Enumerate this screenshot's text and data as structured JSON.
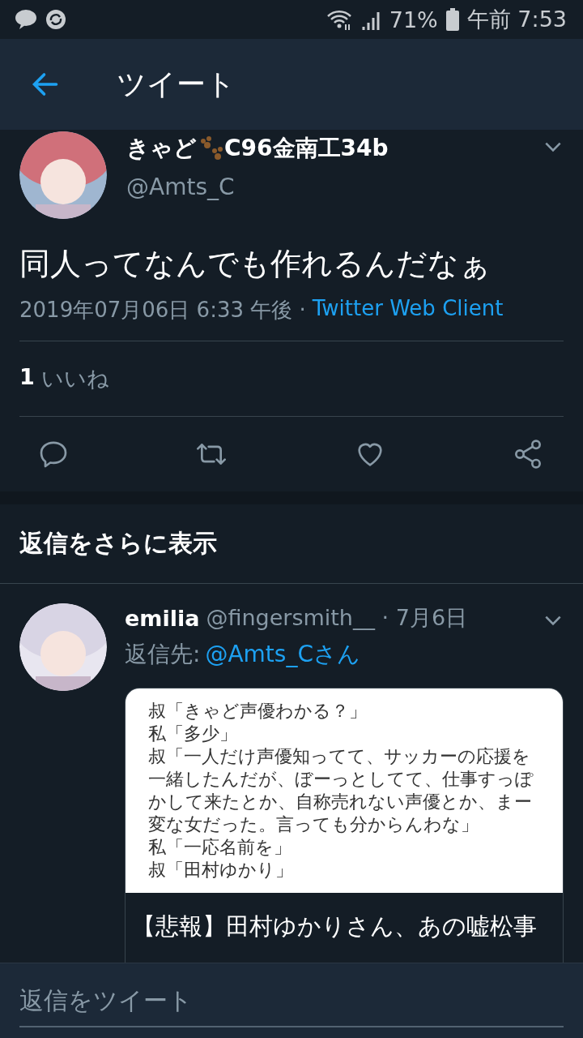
{
  "status_bar": {
    "battery": "71%",
    "time": "午前 7:53"
  },
  "header": {
    "title": "ツイート"
  },
  "tweet": {
    "name_before": "きゃど",
    "name_after": "C96金南工34b",
    "handle": "@Amts_C",
    "text": "同人ってなんでも作れるんだなぁ",
    "timestamp": "2019年07月06日 6:33 午後 ·",
    "client": "Twitter Web Client",
    "like_count": "1",
    "like_label": "いいね"
  },
  "more_replies": {
    "title": "返信をさらに表示"
  },
  "reply": {
    "name": "emilia",
    "handle_date": "@fingersmith__ · 7月6日",
    "reply_to_label": "返信先:",
    "reply_to": "@Amts_Cさん",
    "image_lines": [
      "叔「きゃど声優わかる？」",
      "私「多少」",
      "叔「一人だけ声優知ってて、サッカーの応援を一緒したんだが、ぼーっとしてて、仕事すっぽかして来たとか、自称売れない声優とか、まー変な女だった。言っても分からんわな」",
      "私「一応名前を」",
      "叔「田村ゆかり」"
    ],
    "card_title": "【悲報】田村ゆかりさん、あの嘘松事"
  },
  "compose": {
    "placeholder": "返信をツイート"
  }
}
